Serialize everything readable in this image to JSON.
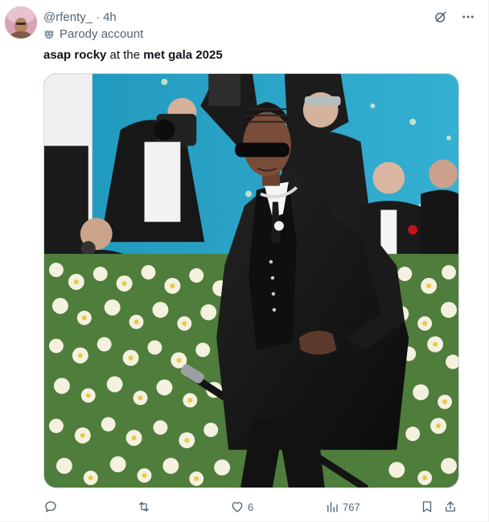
{
  "post": {
    "handle": "@rfenty_",
    "separator": "·",
    "time": "4h",
    "label": "Parody account",
    "text_parts": {
      "bold1": "asap rocky",
      "plain": " at the ",
      "bold2": "met gala 2025"
    },
    "media_icon": "photo",
    "icons": {
      "grok": "grok-icon",
      "more": "more-icon",
      "label": "theater-mask-icon"
    }
  },
  "actions": {
    "reply": {
      "icon": "reply-icon",
      "count": ""
    },
    "repost": {
      "icon": "repost-icon",
      "count": ""
    },
    "like": {
      "icon": "heart-icon",
      "count": "6"
    },
    "views": {
      "icon": "views-icon",
      "count": "767"
    },
    "bookmark": {
      "icon": "bookmark-icon"
    },
    "share": {
      "icon": "share-icon"
    }
  },
  "colors": {
    "text_primary": "#0f1419",
    "text_secondary": "#536471",
    "border": "#cfd9de",
    "backdrop_blue": "#2aa3c6",
    "flower_white": "#f4f1df",
    "foliage_green": "#4f7d3c",
    "coat_black": "#151515"
  }
}
